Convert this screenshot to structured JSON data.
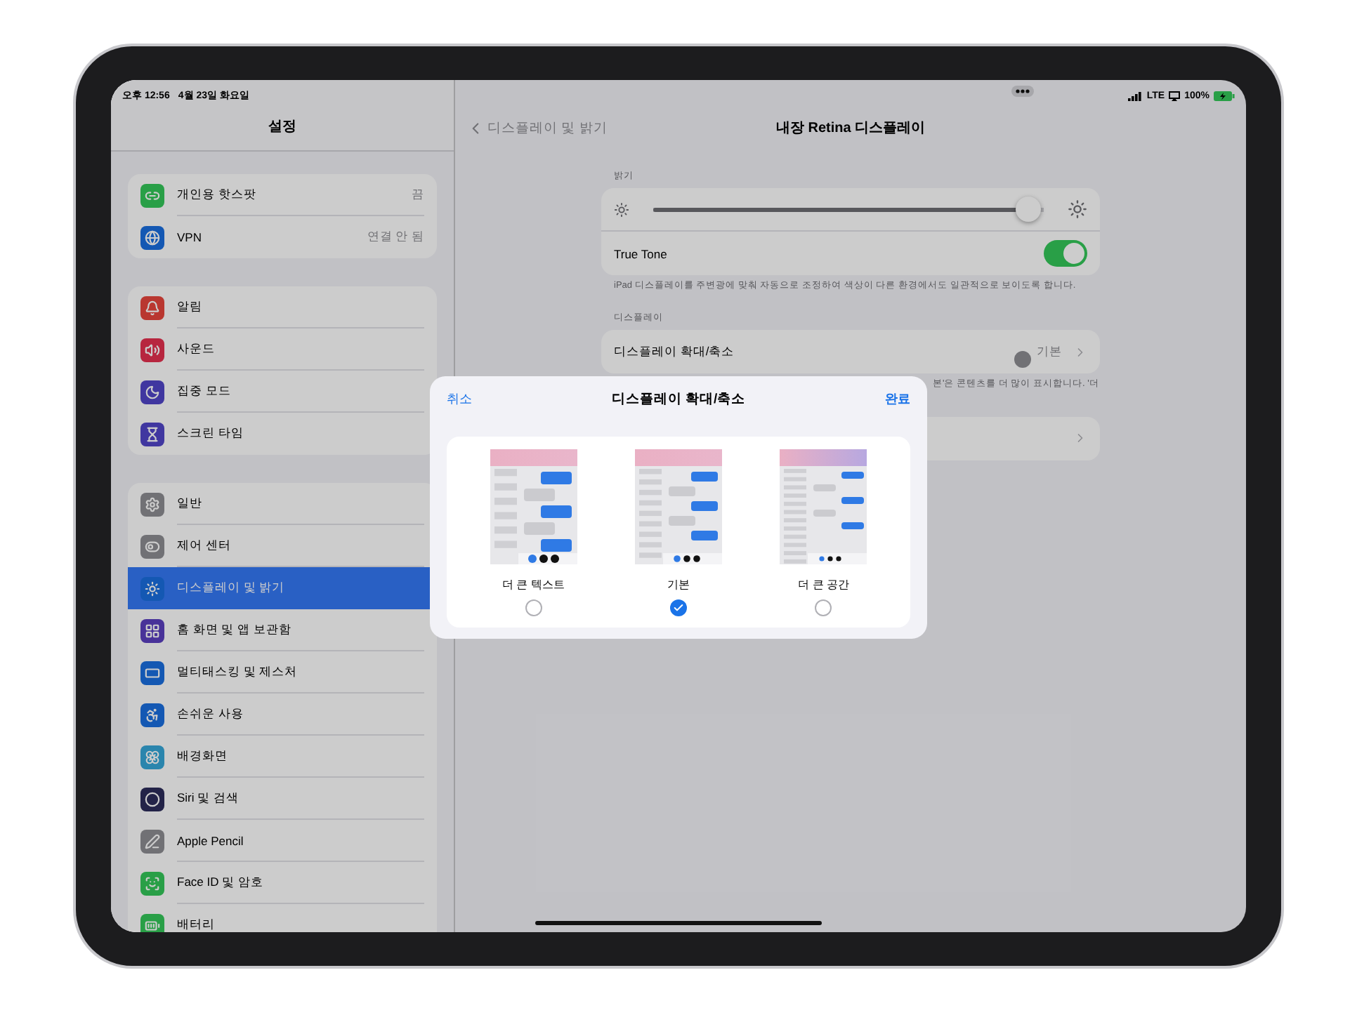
{
  "status_bar": {
    "time": "오후 12:56",
    "date": "4월 23일 화요일",
    "network": "LTE",
    "battery": "100%"
  },
  "sidebar": {
    "title": "설정",
    "groups": [
      {
        "items": [
          {
            "label": "개인용 핫스팟",
            "value": "끔",
            "selected": false
          },
          {
            "label": "VPN",
            "value": "연결 안 됨",
            "selected": false
          }
        ]
      },
      {
        "items": [
          {
            "label": "알림",
            "selected": false
          },
          {
            "label": "사운드",
            "selected": false
          },
          {
            "label": "집중 모드",
            "selected": false
          },
          {
            "label": "스크린 타임",
            "selected": false
          }
        ]
      },
      {
        "items": [
          {
            "label": "일반",
            "selected": false
          },
          {
            "label": "제어 센터",
            "selected": false
          },
          {
            "label": "디스플레이 및 밝기",
            "selected": true
          },
          {
            "label": "홈 화면 및 앱 보관함",
            "selected": false
          },
          {
            "label": "멀티태스킹 및 제스처",
            "selected": false
          },
          {
            "label": "손쉬운 사용",
            "selected": false
          },
          {
            "label": "배경화면",
            "selected": false
          },
          {
            "label": "Siri 및 검색",
            "selected": false
          },
          {
            "label": "Apple Pencil",
            "selected": false
          },
          {
            "label": "Face ID 및 암호",
            "selected": false
          },
          {
            "label": "배터리",
            "selected": false
          }
        ]
      }
    ]
  },
  "detail": {
    "back": "디스플레이 및 밝기",
    "title": "내장 Retina 디스플레이",
    "brightness": {
      "header": "밝기",
      "level": 0.96
    },
    "true_tone": {
      "label": "True Tone",
      "on": true,
      "footnote": "iPad 디스플레이를 주변광에 맞춰 자동으로 조정하여 색상이 다른 환경에서도 일관적으로 보이도록 합니다."
    },
    "display": {
      "header": "디스플레이",
      "label": "디스플레이 확대/축소",
      "value": "기본",
      "footnote": "본'은 콘텐츠를 더 많이 표시합니다. '더"
    }
  },
  "dialog": {
    "cancel": "취소",
    "title": "디스플레이 확대/축소",
    "done": "완료",
    "options": [
      {
        "label": "더 큰 텍스트",
        "selected": false
      },
      {
        "label": "기본",
        "selected": true
      },
      {
        "label": "더 큰 공간",
        "selected": false
      }
    ]
  }
}
